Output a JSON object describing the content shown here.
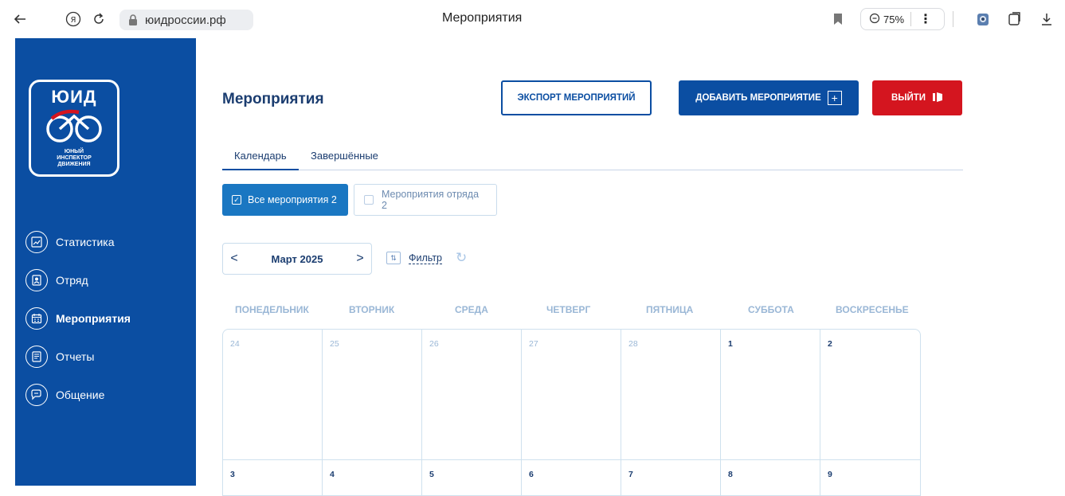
{
  "browser": {
    "url": "юидроссии.рф",
    "tab_title": "Мероприятия",
    "zoom": "75%"
  },
  "logo": {
    "title": "ЮИД",
    "subtitle_lines": [
      "ЮНЫЙ",
      "ИНСПЕКТОР",
      "ДВИЖЕНИЯ"
    ]
  },
  "nav": {
    "items": [
      {
        "label": "Статистика",
        "icon": "chart-icon"
      },
      {
        "label": "Отряд",
        "icon": "team-icon"
      },
      {
        "label": "Мероприятия",
        "icon": "calendar-icon",
        "active": true
      },
      {
        "label": "Отчеты",
        "icon": "report-icon"
      },
      {
        "label": "Общение",
        "icon": "chat-icon"
      }
    ]
  },
  "header": {
    "title": "Мероприятия",
    "export_label": "Экспорт мероприятий",
    "add_label": "Добавить мероприятие",
    "exit_label": "Выйти"
  },
  "tabs": {
    "calendar": "Календарь",
    "completed": "Завершённые"
  },
  "filters": {
    "all_events": "Все мероприятия 2",
    "squad_events": "Мероприятия отряда 2"
  },
  "month_nav": {
    "prev": "<",
    "label": "Март 2025",
    "next": ">",
    "filter_label": "Фильтр"
  },
  "weekdays": [
    "Понедельник",
    "Вторник",
    "Среда",
    "Четверг",
    "Пятница",
    "Суббота",
    "Воскресенье"
  ],
  "calendar": {
    "week1": [
      {
        "day": "24",
        "current": false
      },
      {
        "day": "25",
        "current": false
      },
      {
        "day": "26",
        "current": false
      },
      {
        "day": "27",
        "current": false
      },
      {
        "day": "28",
        "current": false
      },
      {
        "day": "1",
        "current": true
      },
      {
        "day": "2",
        "current": true
      }
    ],
    "week2": [
      {
        "day": "3",
        "current": true
      },
      {
        "day": "4",
        "current": true
      },
      {
        "day": "5",
        "current": true
      },
      {
        "day": "6",
        "current": true
      },
      {
        "day": "7",
        "current": true
      },
      {
        "day": "8",
        "current": true
      },
      {
        "day": "9",
        "current": true
      }
    ]
  },
  "colors": {
    "brand_blue": "#0b4ea2",
    "danger_red": "#d4151f",
    "chip_blue": "#1a77c2",
    "title_navy": "#1b3d70"
  }
}
